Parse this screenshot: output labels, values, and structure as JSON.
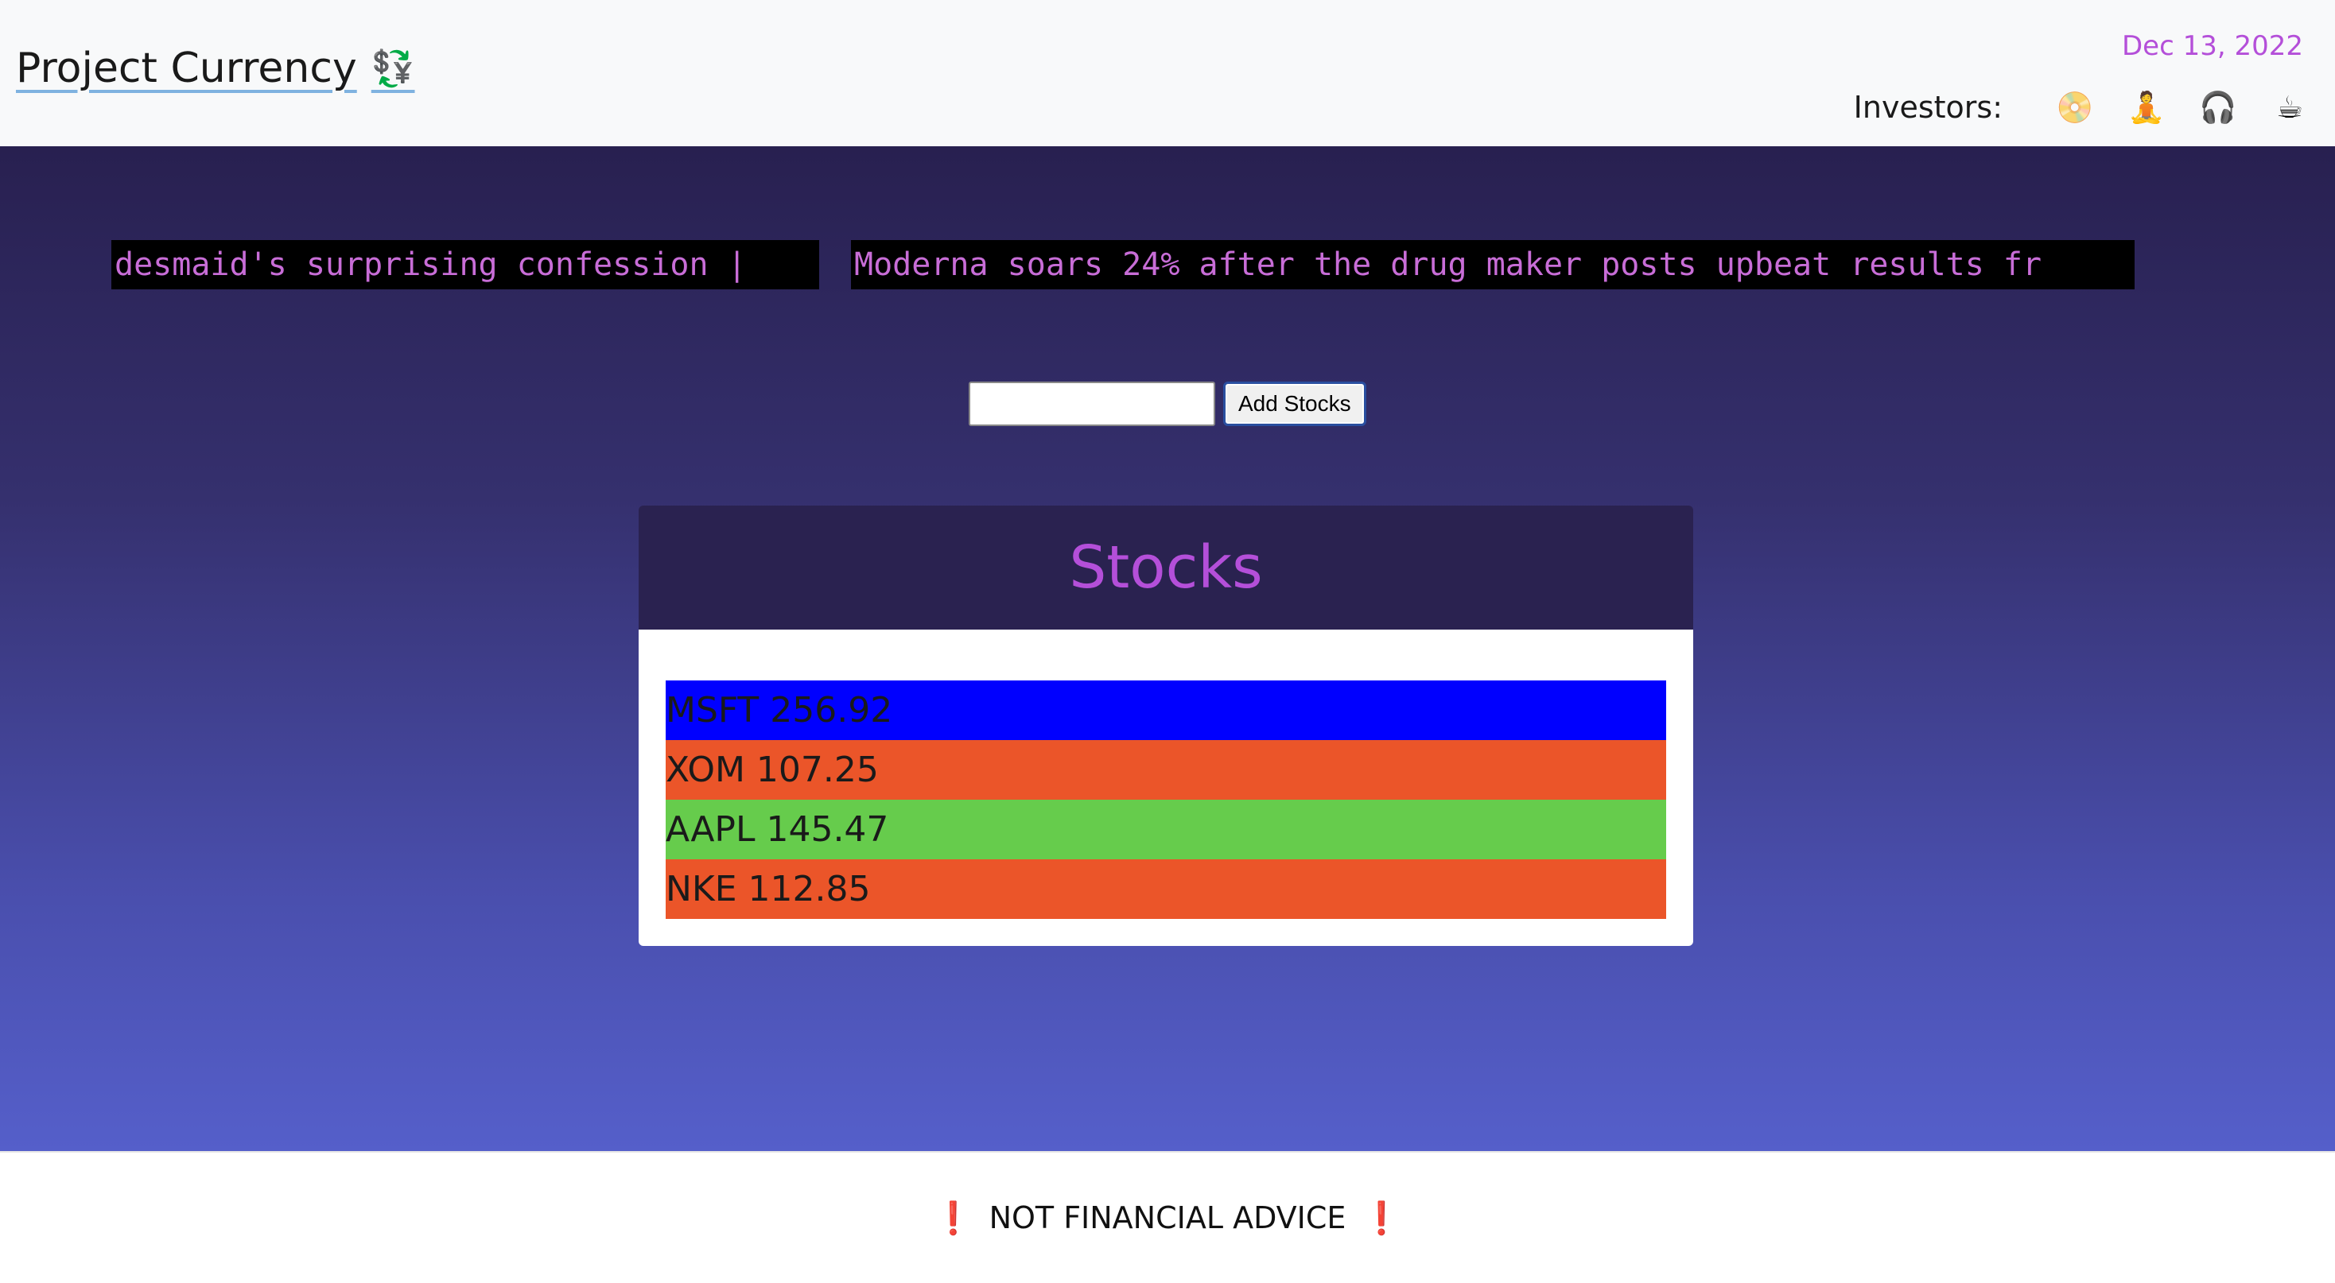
{
  "header": {
    "title": "Project Currency",
    "brand_icon": "💱",
    "date": "Dec 13, 2022",
    "investors_label": "Investors:",
    "investors": [
      {
        "icon": "📀",
        "name": "disc-icon"
      },
      {
        "icon": "🧘",
        "name": "person-meditating-icon"
      },
      {
        "icon": "🎧",
        "name": "headphones-icon"
      },
      {
        "icon": "☕",
        "name": "coffee-icon"
      }
    ]
  },
  "ticker": {
    "items": [
      "desmaid's surprising confession |",
      "Moderna soars 24% after the drug maker posts upbeat results fr"
    ]
  },
  "form": {
    "input_value": "",
    "button_label": "Add Stocks"
  },
  "stocks": {
    "title": "Stocks",
    "items": [
      {
        "label": "MSFT 256.92",
        "color": "#0000ff"
      },
      {
        "label": "XOM 107.25",
        "color": "#eb5529"
      },
      {
        "label": "AAPL 145.47",
        "color": "#66cc4c"
      },
      {
        "label": "NKE 112.85",
        "color": "#eb5529"
      }
    ]
  },
  "footer": {
    "icon": "❗",
    "text": "NOT FINANCIAL ADVICE"
  },
  "colors": {
    "accent": "#b44fd9",
    "header_bg": "#f8f9fa",
    "card_header_bg": "#2a2250"
  }
}
